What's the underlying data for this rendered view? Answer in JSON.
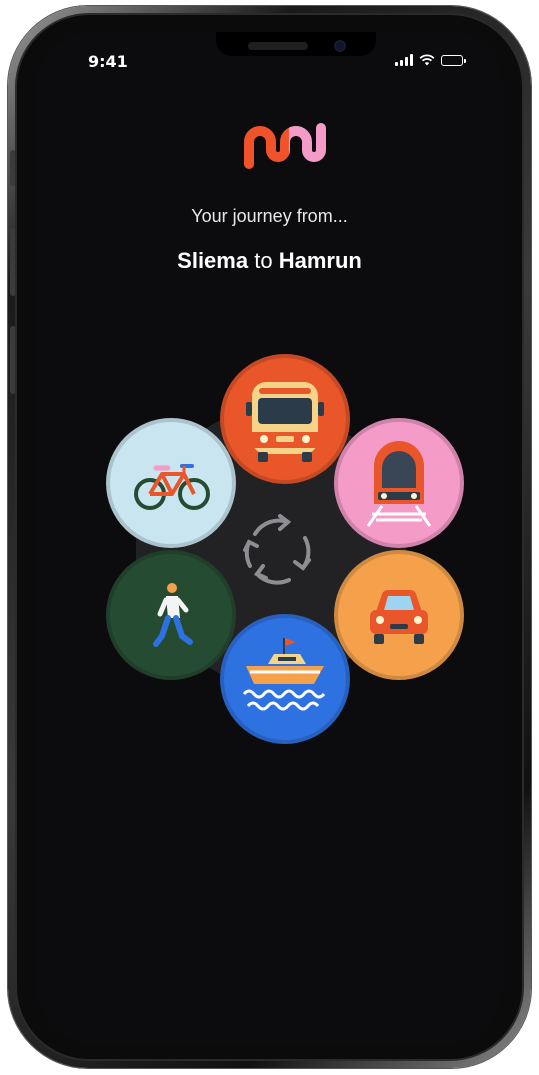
{
  "status_bar": {
    "time": "9:41"
  },
  "app": {
    "logo_icon": "app-logo-icon"
  },
  "journey": {
    "subtitle": "Your journey from...",
    "origin": "Sliema",
    "connector": "to",
    "destination": "Hamrun"
  },
  "transport_modes": [
    {
      "name": "bus",
      "icon": "bus-icon",
      "color": "#E8562A"
    },
    {
      "name": "train",
      "icon": "train-icon",
      "color": "#F59BC8"
    },
    {
      "name": "car",
      "icon": "car-icon",
      "color": "#F5A14C"
    },
    {
      "name": "ferry",
      "icon": "ferry-icon",
      "color": "#2E71E0"
    },
    {
      "name": "walk",
      "icon": "walking-person-icon",
      "color": "#264B33"
    },
    {
      "name": "bicycle",
      "icon": "bicycle-icon",
      "color": "#C9E5F0"
    }
  ],
  "center": {
    "icon": "refresh-cycle-icon"
  }
}
